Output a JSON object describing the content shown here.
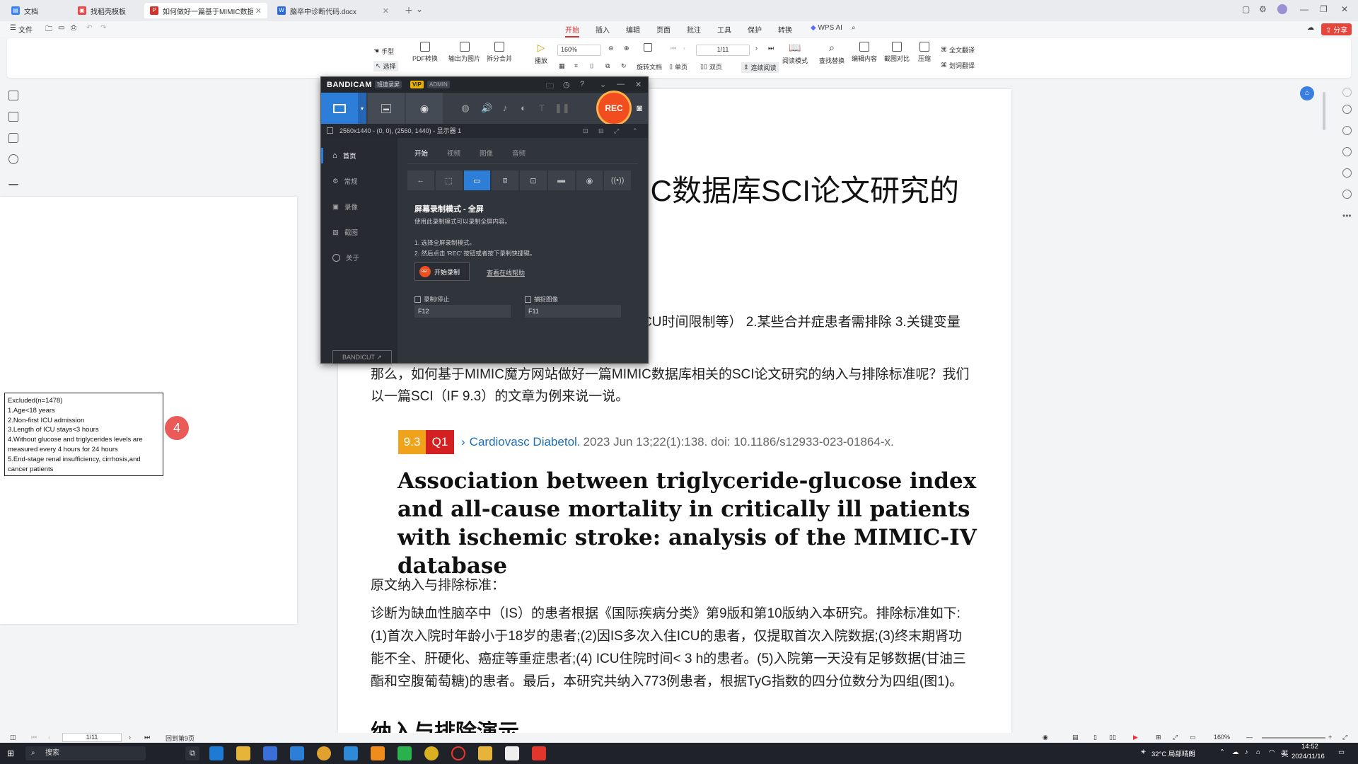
{
  "tabs": [
    {
      "label": "文档",
      "color": "#3b82f6"
    },
    {
      "label": "找稻壳模板",
      "color": "#e64a4a"
    },
    {
      "label": "如何做好一篇基于MIMIC数据...",
      "color": "#d4322b"
    },
    {
      "label": "脑卒中诊断代码.docx",
      "color": "#2b6be0"
    }
  ],
  "menu": {
    "file": "文件",
    "items": [
      "开始",
      "插入",
      "编辑",
      "页面",
      "批注",
      "工具",
      "保护",
      "转换"
    ],
    "wps_ai": "WPS AI",
    "share": "分享"
  },
  "ribbon": {
    "hand": "手型",
    "select": "选择",
    "pdf_convert": "PDF转换",
    "export_image": "输出为图片",
    "split_merge": "拆分合并",
    "play": "播放",
    "zoom": "160%",
    "page": "1/11",
    "rotate": "旋转文档",
    "single": "单页",
    "double": "双页",
    "continuous": "连续阅读",
    "read_mode": "阅读模式",
    "find_replace": "查找替换",
    "edit_content": "编辑内容",
    "compare": "截图对比",
    "compress": "压缩",
    "translate_full": "全文翻译",
    "translate_word": "划词翻译"
  },
  "left_page": {
    "excluded_box": [
      "Excluded(n=1478)",
      "1.Age<18 years",
      "2.Non-first ICU admission",
      "3.Length of ICU stays<3 hours",
      "4.Without glucose and triglycerides levels are",
      "measured every 4 hours for 24 hours",
      "5.End-stage renal insufficiency, cirrhosis,and",
      "cancer  patients"
    ],
    "badge": "4"
  },
  "document": {
    "title_fragment": "IC数据库SCI论文研究的",
    "line_partial": "CU时间限制等） 2.某些合并症患者需排除 3.关键变量",
    "intro_1": "那么，如何基于MIMIC魔方网站做好一篇MIMIC数据库相关的SCI论文研究的纳入与排除标准呢？我们",
    "intro_2": "以一篇SCI（IF 9.3）的文章为例来说一说。",
    "if_badge": "9.3",
    "q_badge": "Q1",
    "journal": "Cardiovasc Diabetol.",
    "citation_rest": "2023 Jun 13;22(1):138. doi: 10.1186/s12933-023-01864-x.",
    "paper_title": "Association between triglyceride-glucose index and all-cause mortality in critically ill patients with ischemic stroke: analysis of the MIMIC-IV database",
    "orig_label": "原文纳入与排除标准：",
    "para_1": "诊断为缺血性脑卒中（IS）的患者根据《国际疾病分类》第9版和第10版纳入本研究。排除标准如下:",
    "para_2": "(1)首次入院时年龄小于18岁的患者;(2)因IS多次入住ICU的患者，仅提取首次入院数据;(3)终末期肾功",
    "para_3": "能不全、肝硬化、癌症等重症患者;(4) ICU住院时间< 3 h的患者。(5)入院第一天没有足够数据(甘油三",
    "para_4": "酯和空腹葡萄糖)的患者。最后，本研究共纳入773例患者，根据TyG指数的四分位数分为四组(图1)。",
    "section_heading": "纳入与排除演示"
  },
  "bandicam": {
    "brand": "BANDICAM",
    "chip1": "班迪录屏",
    "chip2": "VIP",
    "chip3": "ADMIN",
    "rec": "REC",
    "status": "2560x1440 - (0, 0), (2560, 1440) - 显示器 1",
    "side": [
      "首页",
      "常规",
      "录像",
      "截图",
      "关于"
    ],
    "bandicut": "BANDICUT ↗",
    "tabs": [
      "开始",
      "视频",
      "图像",
      "音频"
    ],
    "mode_title": "屏幕录制模式 - 全屏",
    "mode_desc": "使用此录制模式可以录制全屏内容。",
    "step1": "1. 选择全屏录制模式。",
    "step2": "2. 然后点击 'REC' 按钮或者按下录制快捷键。",
    "start_btn": "开始录制",
    "help": "查看在线帮助",
    "hk1_label": "录制/停止",
    "hk1": "F12",
    "hk2_label": "捕捉图像",
    "hk2": "F11"
  },
  "statusbar": {
    "page": "1/11",
    "back": "回到第9页",
    "zoom": "160%"
  },
  "taskbar": {
    "search": "搜索",
    "weather": "32°C 局部晴朗",
    "lang": "英",
    "time": "14:52",
    "date": "2024/11/16"
  }
}
